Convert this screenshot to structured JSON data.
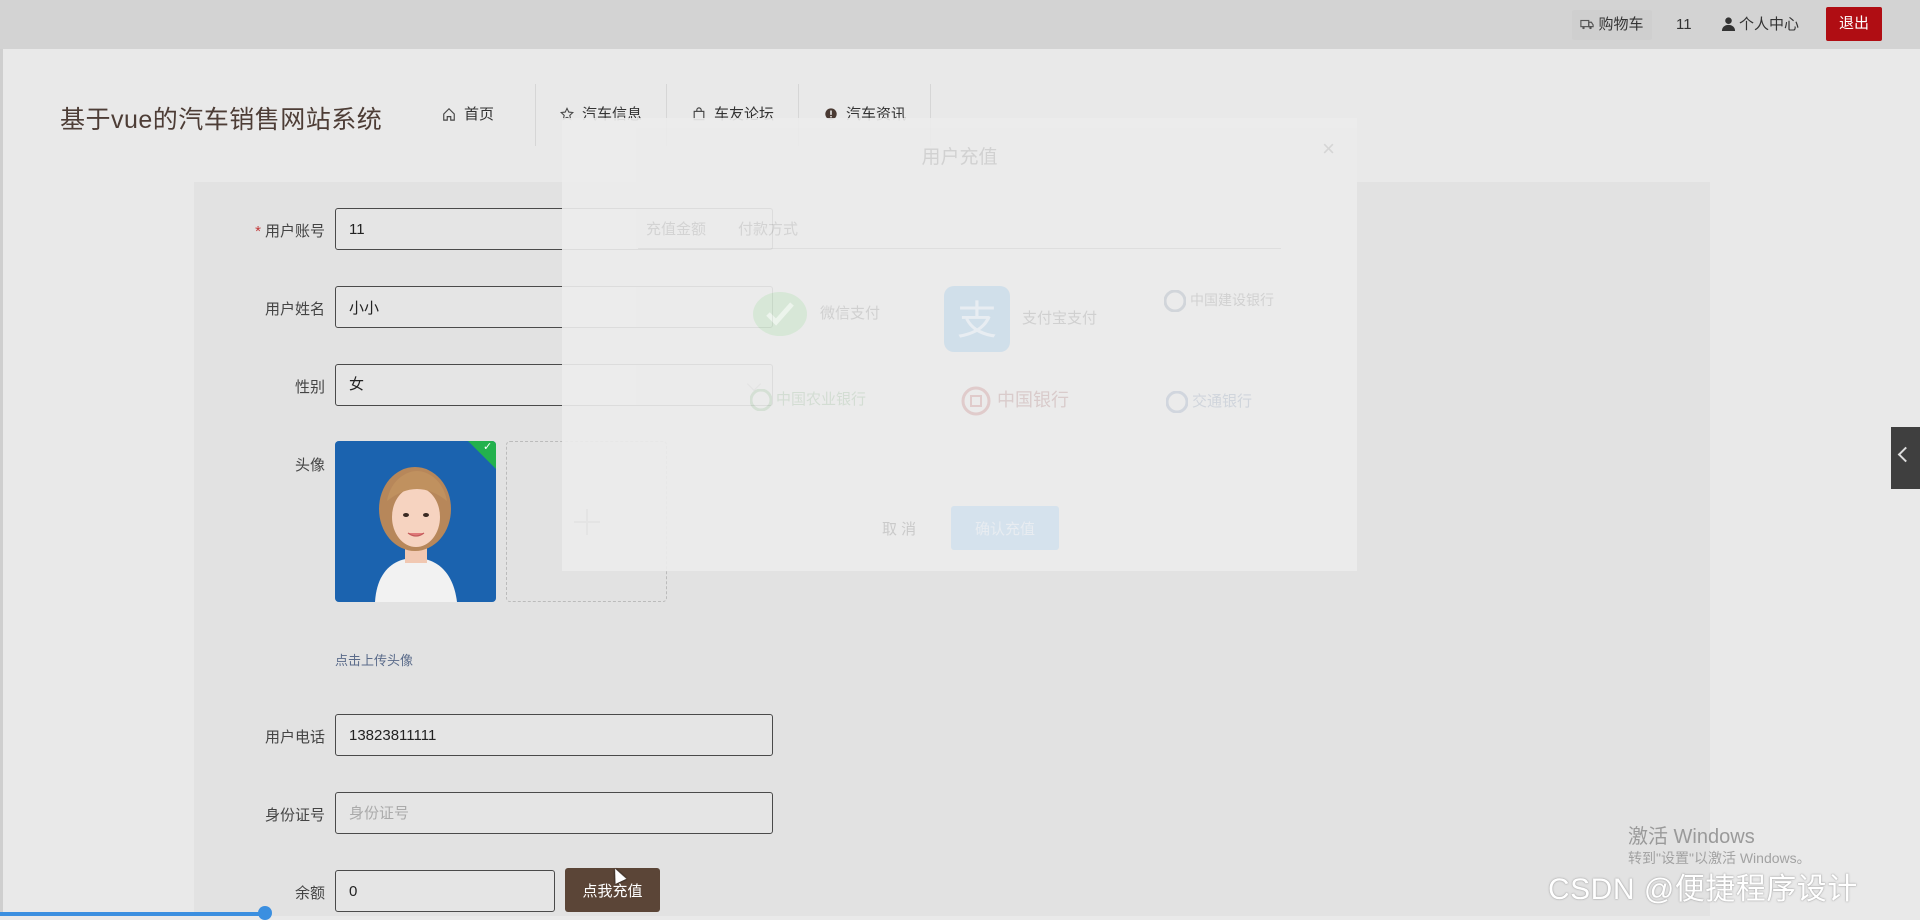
{
  "topbar": {
    "cart_label": "购物车",
    "user_number": "11",
    "profile_label": "个人中心",
    "logout_label": "退出"
  },
  "site": {
    "title": "基于vue的汽车销售网站系统"
  },
  "nav": [
    {
      "label": "首页",
      "icon": "home-icon"
    },
    {
      "label": "汽车信息",
      "icon": "star-icon"
    },
    {
      "label": "车友论坛",
      "icon": "bag-icon"
    },
    {
      "label": "汽车资讯",
      "icon": "info-icon"
    }
  ],
  "form": {
    "account": {
      "label": "用户账号",
      "value": "11",
      "required": true
    },
    "name": {
      "label": "用户姓名",
      "value": "小小"
    },
    "gender": {
      "label": "性别",
      "value": "女"
    },
    "avatar": {
      "label": "头像",
      "upload_hint": "点击上传头像"
    },
    "phone": {
      "label": "用户电话",
      "value": "13823811111"
    },
    "id_card": {
      "label": "身份证号",
      "placeholder": "身份证号",
      "value": ""
    },
    "balance": {
      "label": "余额",
      "value": "0"
    },
    "recharge_label": "点我充值"
  },
  "modal": {
    "title": "用户充值",
    "tabs": [
      "充值金额",
      "付款方式"
    ],
    "payment_methods": [
      {
        "label": "微信支付",
        "icon": "wechat-pay-icon"
      },
      {
        "label": "支付宝支付",
        "icon": "alipay-icon"
      },
      {
        "label": "中国建设银行",
        "icon": "ccb-logo"
      },
      {
        "label": "中国农业银行",
        "icon": "abc-logo"
      },
      {
        "label": "中国银行",
        "icon": "boc-logo"
      },
      {
        "label": "交通银行",
        "icon": "bocom-logo"
      }
    ],
    "cancel_label": "取 消",
    "confirm_label": "确认充值"
  },
  "watermark": {
    "windows_title": "激活 Windows",
    "windows_sub": "转到\"设置\"以激活 Windows。",
    "csdn": "CSDN @便捷程序设计"
  },
  "colors": {
    "brand_brown": "#5b4537",
    "logout_red": "#b00d13",
    "success_green": "#23b14d"
  }
}
